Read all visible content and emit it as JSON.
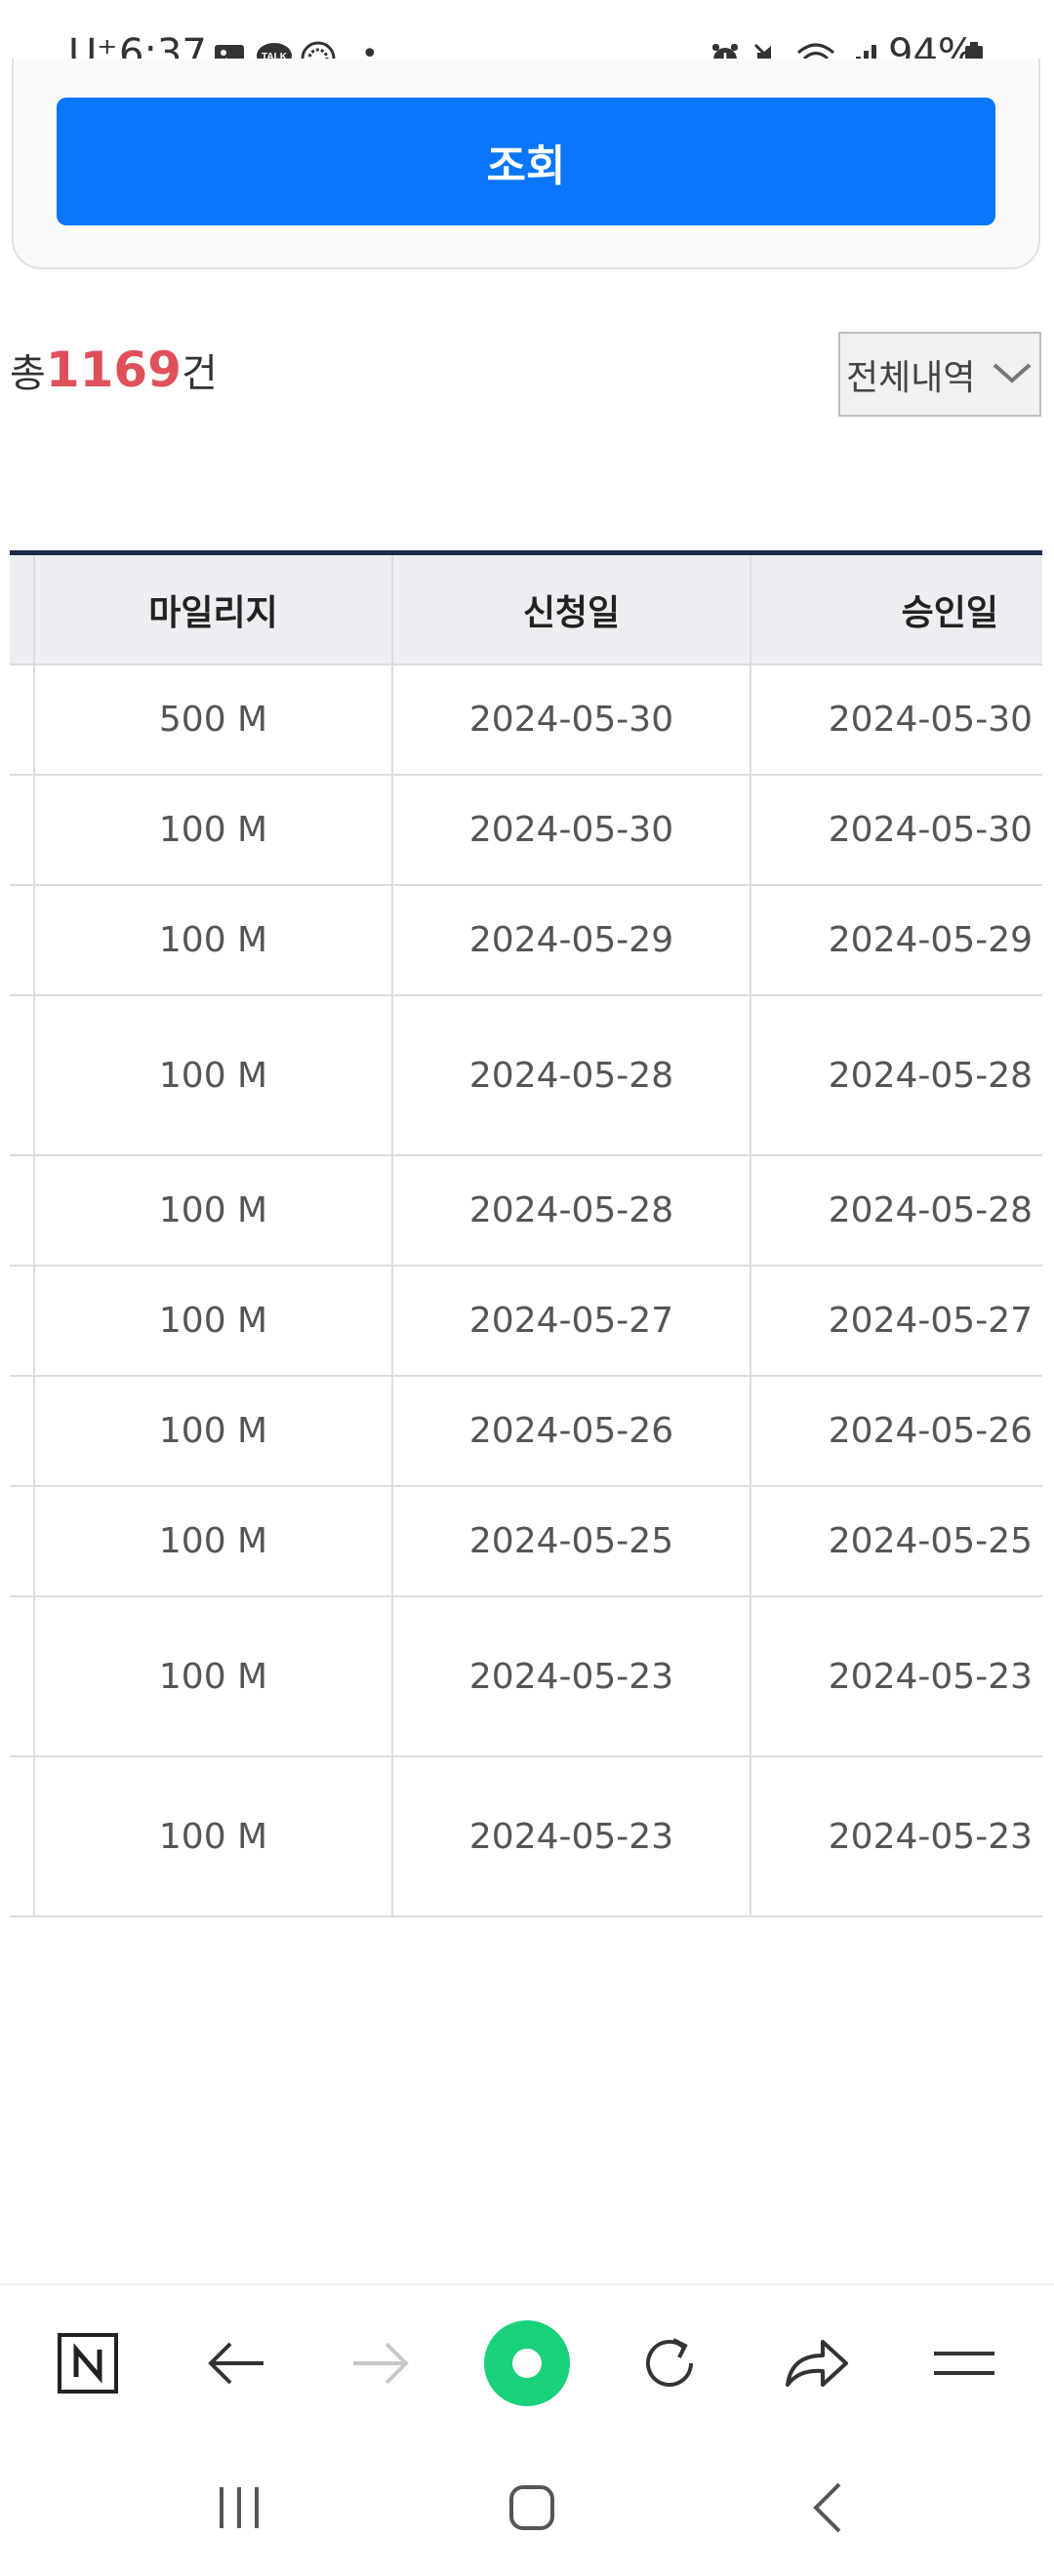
{
  "status_bar": {
    "carrier": "U⁺",
    "time": "6:37",
    "dot": "•",
    "battery": "94%"
  },
  "search": {
    "button_label": "조회"
  },
  "summary": {
    "prefix": "총",
    "count": "1169",
    "suffix": "건",
    "filter_selected": "전체내역"
  },
  "table": {
    "headers": [
      "마일리지",
      "신청일",
      "승인일"
    ],
    "rows": [
      {
        "mileage": "500 M",
        "applied": "2024-05-30",
        "approved": "2024-05-30"
      },
      {
        "mileage": "100 M",
        "applied": "2024-05-30",
        "approved": "2024-05-30"
      },
      {
        "mileage": "100 M",
        "applied": "2024-05-29",
        "approved": "2024-05-29"
      },
      {
        "mileage": "100 M",
        "applied": "2024-05-28",
        "approved": "2024-05-28"
      },
      {
        "mileage": "100 M",
        "applied": "2024-05-28",
        "approved": "2024-05-28"
      },
      {
        "mileage": "100 M",
        "applied": "2024-05-27",
        "approved": "2024-05-27"
      },
      {
        "mileage": "100 M",
        "applied": "2024-05-26",
        "approved": "2024-05-26"
      },
      {
        "mileage": "100 M",
        "applied": "2024-05-25",
        "approved": "2024-05-25"
      },
      {
        "mileage": "100 M",
        "applied": "2024-05-23",
        "approved": "2024-05-23"
      },
      {
        "mileage": "100 M",
        "applied": "2024-05-23",
        "approved": "2024-05-23"
      }
    ]
  },
  "browser_bar": {
    "items": [
      "naver-home-icon",
      "back-arrow-icon",
      "forward-arrow-icon",
      "green-dot-icon",
      "refresh-icon",
      "share-icon",
      "menu-icon"
    ]
  },
  "colors": {
    "accent": "#0a76fb",
    "count_red": "#e0505a",
    "table_top_line": "#1c2d4a",
    "green": "#19d17a"
  }
}
